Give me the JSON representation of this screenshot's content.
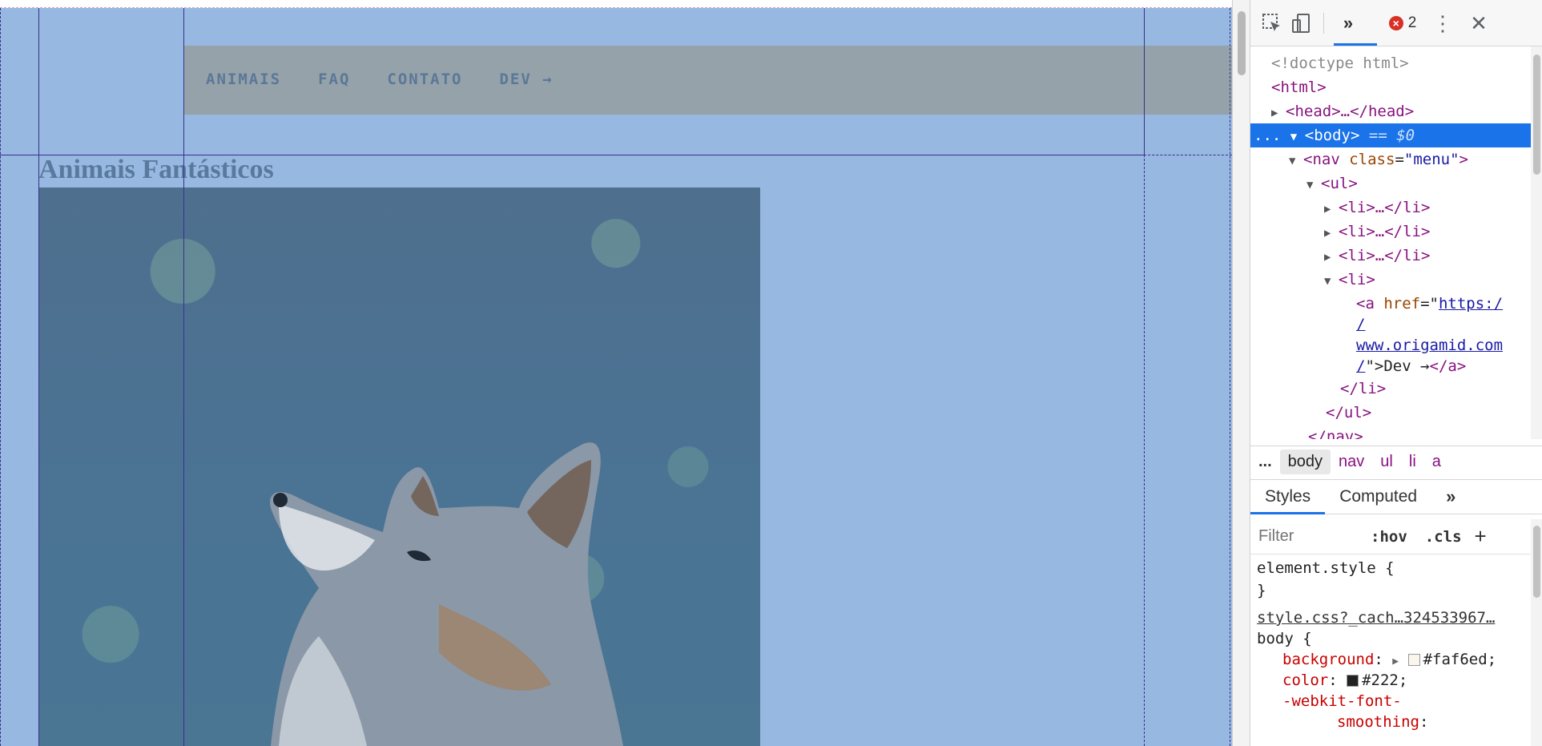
{
  "page": {
    "menu": [
      {
        "label": "ANIMAIS"
      },
      {
        "label": "FAQ"
      },
      {
        "label": "CONTATO"
      },
      {
        "label": "DEV →"
      }
    ],
    "title": "Animais Fantásticos",
    "photo_subject": "fox"
  },
  "devtools": {
    "toolbar": {
      "inspect_icon": "inspect-element-icon",
      "device_icon": "device-toolbar-icon",
      "more_tabs_label": "»",
      "error_count": "2",
      "menu_icon": "kebab-menu-icon",
      "close_label": "✕"
    },
    "dom": {
      "doctype": "<!doctype html>",
      "html_open": "<html>",
      "head": "<head>…</head>",
      "body": "<body>",
      "body_suffix": "== $0",
      "nav_tag": "nav",
      "nav_attr_name": "class",
      "nav_attr_value": "\"menu\"",
      "ul_open": "<ul>",
      "li_collapsed": [
        "<li>…</li>",
        "<li>…</li>",
        "<li>…</li>"
      ],
      "li_open": "<li>",
      "a_attr_name": "href",
      "href_part1": "https:/",
      "href_part2": "/",
      "href_part3": "www.origamid.com",
      "href_part4": "/",
      "a_text": "Dev →",
      "li_close": "</li>",
      "ul_close": "</ul>",
      "nav_close": "</nav>",
      "selected_prefix": "..."
    },
    "breadcrumbs": [
      "...",
      "body",
      "nav",
      "ul",
      "li",
      "a"
    ],
    "styles_tabs": [
      "Styles",
      "Computed",
      "»"
    ],
    "filter": {
      "placeholder": "Filter",
      "hov": ":hov",
      "cls": ".cls",
      "add": "+"
    },
    "rules": {
      "element_style_open": "element.style {",
      "close_brace": "}",
      "source": "style.css?_cach…324533967…",
      "selector": "body {",
      "props": [
        {
          "name": "background",
          "value": "#faf6ed;",
          "swatch": "#faf6ed"
        },
        {
          "name": "color",
          "value": "#222;",
          "swatch": "#222222"
        },
        {
          "name": "-webkit-font-",
          "value": ""
        },
        {
          "name": "smoothing",
          "value": ""
        }
      ]
    }
  }
}
